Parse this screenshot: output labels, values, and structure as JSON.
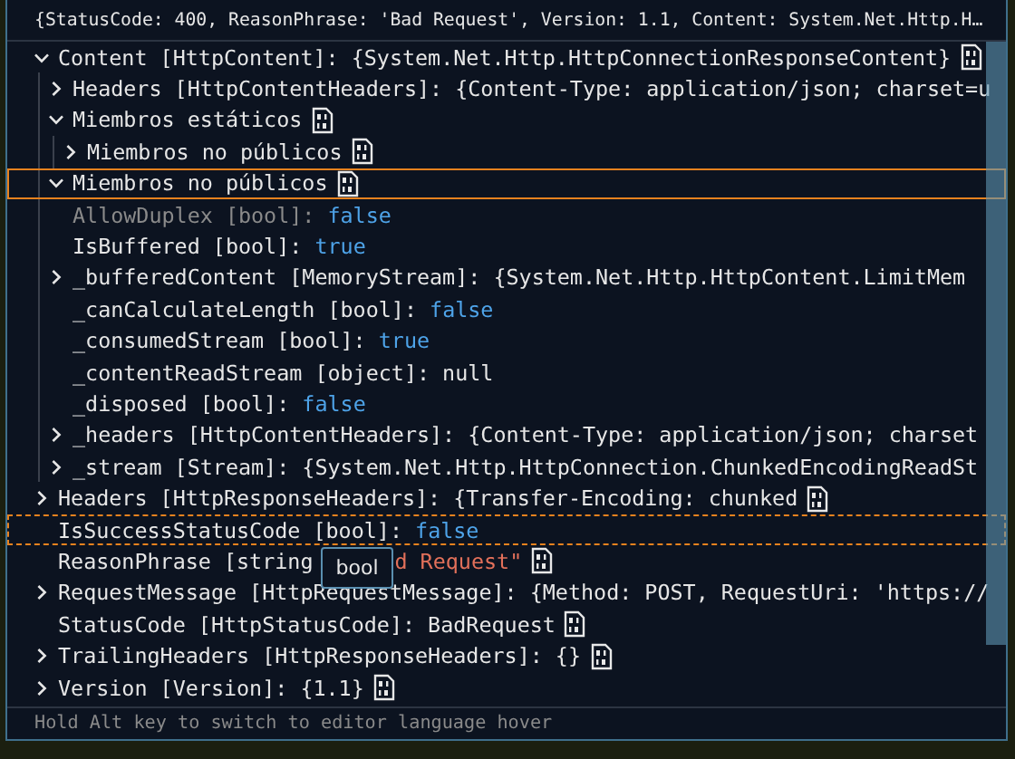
{
  "header": {
    "text": "{StatusCode: 400, ReasonPhrase: 'Bad Request', Version: 1.1, Content: System.Net.Http.H…"
  },
  "tree": [
    {
      "text": "Content [HttpContent]: {System.Net.Http.HttpConnectionResponseContent}",
      "icon": true,
      "expanded": true,
      "selected": false,
      "hovered": false,
      "disabled": false,
      "children": [
        {
          "text": "Headers [HttpContentHeaders]: {Content-Type: application/json; charset=u",
          "icon": false,
          "expanded": false,
          "selected": false,
          "hovered": false,
          "disabled": false
        },
        {
          "text": "Miembros estáticos",
          "icon": true,
          "expanded": true,
          "selected": false,
          "hovered": false,
          "disabled": false,
          "children": [
            {
              "text": "Miembros no públicos",
              "icon": true,
              "expanded": false,
              "selected": false,
              "hovered": false,
              "disabled": false
            }
          ]
        },
        {
          "text": "Miembros no públicos",
          "icon": true,
          "expanded": true,
          "selected": true,
          "hovered": false,
          "disabled": false
        },
        {
          "text": "AllowDuplex [bool]: ",
          "kind": "keyword",
          "value": "false",
          "icon": false,
          "selected": false,
          "hovered": false,
          "disabled": true
        },
        {
          "text": "IsBuffered [bool]: ",
          "kind": "keyword",
          "value": "true",
          "icon": false,
          "selected": false,
          "hovered": false,
          "disabled": false
        },
        {
          "text": "_bufferedContent [MemoryStream]: {System.Net.Http.HttpContent.LimitMem",
          "icon": false,
          "expanded": false,
          "selected": false,
          "hovered": false,
          "disabled": false
        },
        {
          "text": "_canCalculateLength [bool]: ",
          "kind": "keyword",
          "value": "false",
          "icon": false,
          "selected": false,
          "hovered": false,
          "disabled": false
        },
        {
          "text": "_consumedStream [bool]: ",
          "kind": "keyword",
          "value": "true",
          "icon": false,
          "selected": false,
          "hovered": false,
          "disabled": false
        },
        {
          "text": "_contentReadStream [object]: null",
          "icon": false,
          "selected": false,
          "hovered": false,
          "disabled": false
        },
        {
          "text": "_disposed [bool]: ",
          "kind": "keyword",
          "value": "false",
          "icon": false,
          "selected": false,
          "hovered": false,
          "disabled": false
        },
        {
          "text": "_headers [HttpContentHeaders]: {Content-Type: application/json; charset",
          "icon": false,
          "expanded": false,
          "selected": false,
          "hovered": false,
          "disabled": false
        },
        {
          "text": "_stream [Stream]: {System.Net.Http.HttpConnection.ChunkedEncodingReadSt",
          "icon": false,
          "expanded": false,
          "selected": false,
          "hovered": false,
          "disabled": false
        }
      ]
    },
    {
      "text": "Headers [HttpResponseHeaders]: {Transfer-Encoding: chunked",
      "icon": true,
      "expanded": false,
      "selected": false,
      "hovered": false,
      "disabled": false
    },
    {
      "text": "IsSuccessStatusCode [bool]: ",
      "kind": "keyword",
      "value": "false",
      "icon": false,
      "selected": false,
      "hovered": true,
      "disabled": false
    },
    {
      "text": "ReasonPhrase [string",
      "kind": "string",
      "tooltip": "bool",
      "value": "d Request\"",
      "icon": true,
      "selected": false,
      "hovered": false,
      "disabled": false
    },
    {
      "text": "RequestMessage [HttpRequestMessage]: {Method: POST, RequestUri: 'https://",
      "icon": false,
      "expanded": false,
      "selected": false,
      "hovered": false,
      "disabled": false
    },
    {
      "text": "StatusCode [HttpStatusCode]: BadRequest",
      "icon": true,
      "selected": false,
      "hovered": false,
      "disabled": false
    },
    {
      "text": "TrailingHeaders [HttpResponseHeaders]: {}",
      "icon": true,
      "expanded": false,
      "selected": false,
      "hovered": false,
      "disabled": false
    },
    {
      "text": "Version [Version]: {1.1}",
      "icon": true,
      "expanded": false,
      "selected": false,
      "hovered": false,
      "disabled": false
    }
  ],
  "footer": {
    "text": "Hold Alt key to switch to editor language hover"
  }
}
